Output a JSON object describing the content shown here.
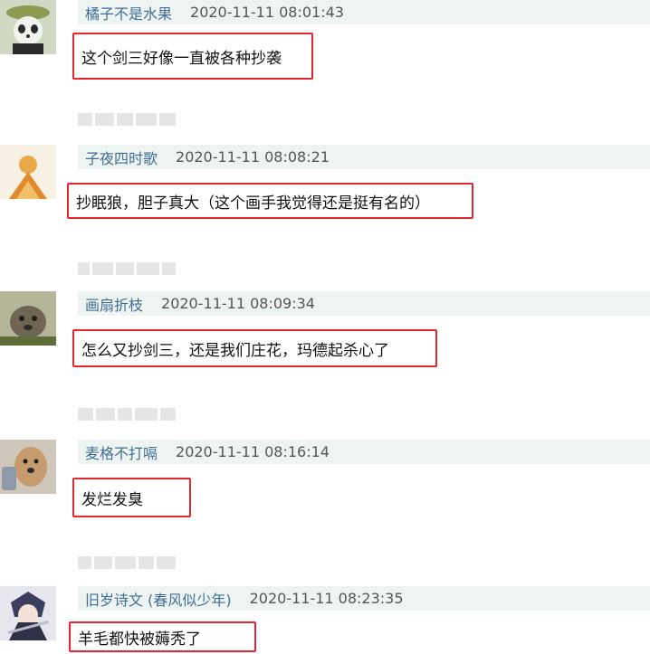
{
  "comments": [
    {
      "author": "橘子不是水果",
      "author_suffix": "",
      "time": "2020-11-11 08:01:43",
      "text": "这个剑三好像一直被各种抄袭"
    },
    {
      "author": "子夜四时歌",
      "author_suffix": "",
      "time": "2020-11-11 08:08:21",
      "text": "抄眠狼，胆子真大（这个画手我觉得还是挺有名的）"
    },
    {
      "author": "画扇折枝",
      "author_suffix": "",
      "time": "2020-11-11 08:09:34",
      "text": "怎么又抄剑三，还是我们庄花，玛德起杀心了"
    },
    {
      "author": "麦格不打嗝",
      "author_suffix": "",
      "time": "2020-11-11 08:16:14",
      "text": "发烂发臭"
    },
    {
      "author": "旧岁诗文",
      "author_suffix": "(春风似少年)",
      "time": "2020-11-11 08:23:35",
      "text": "羊毛都快被薅秃了"
    }
  ],
  "colors": {
    "author": "#3f6d93",
    "header_bg": "#eef4f2",
    "highlight_border": "#e3262f"
  }
}
